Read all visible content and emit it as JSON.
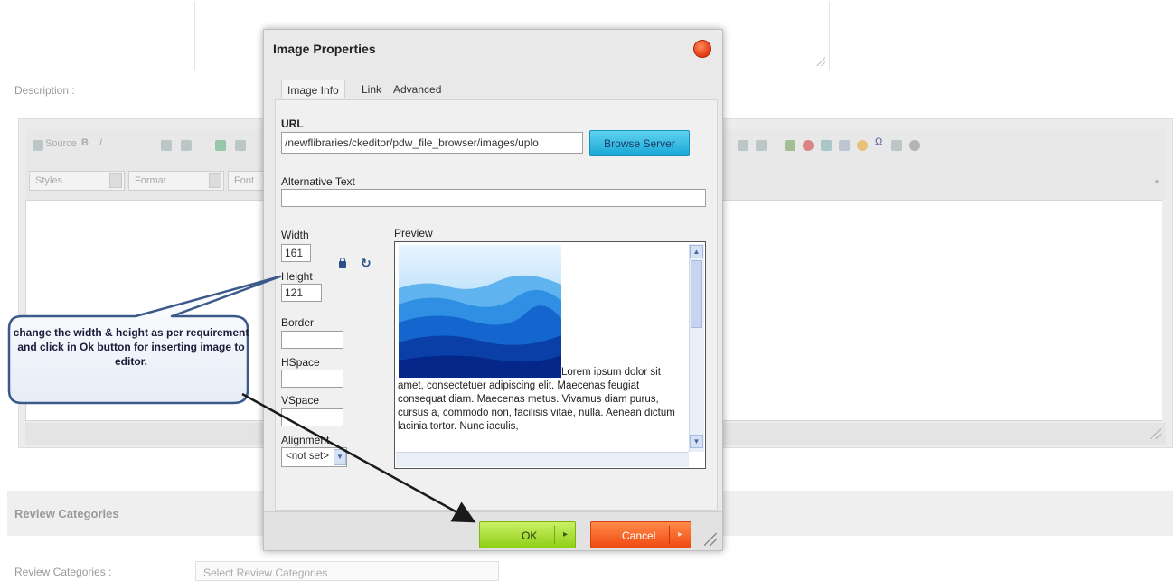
{
  "background": {
    "description_label": "Description :",
    "section_title": "Review Categories",
    "review_categories_label": "Review Categories :",
    "review_categories_select": "Select Review Categories",
    "toolbar": {
      "source_label": "Source",
      "styles_label": "Styles",
      "format_label": "Format",
      "font_label": "Font"
    }
  },
  "dialog": {
    "title": "Image Properties",
    "tabs": [
      "Image Info",
      "Link",
      "Advanced"
    ],
    "active_tab": "Image Info",
    "url_label": "URL",
    "url_value": "/newflibraries/ckeditor/pdw_file_browser/images/uplo",
    "browse_button": "Browse Server",
    "alt_label": "Alternative Text",
    "alt_value": "",
    "width_label": "Width",
    "width_value": "161",
    "height_label": "Height",
    "height_value": "121",
    "border_label": "Border",
    "border_value": "",
    "hspace_label": "HSpace",
    "hspace_value": "",
    "vspace_label": "VSpace",
    "vspace_value": "",
    "alignment_label": "Alignment",
    "alignment_value": "<not set>",
    "preview_label": "Preview",
    "preview_text": "Lorem ipsum dolor sit amet, consectetuer adipiscing elit. Maecenas feugiat consequat diam. Maecenas metus. Vivamus diam purus, cursus a, commodo non, facilisis vitae, nulla. Aenean dictum lacinia tortor. Nunc iaculis,",
    "ok_button": "OK",
    "cancel_button": "Cancel"
  },
  "callout": {
    "text": "change the width & height as per requirement and click in Ok button for inserting image to editor."
  },
  "colors": {
    "browse_button": "#19a7d6",
    "ok_button": "#8fcf17",
    "cancel_button": "#ef4a12",
    "close_button": "#e03a10",
    "callout_border": "#3b5a8a"
  },
  "icons": [
    "close-icon",
    "lock-icon",
    "reset-size-icon",
    "scroll-up-icon",
    "scroll-down-icon",
    "dropdown-arrow-icon",
    "resize-grip-icon"
  ]
}
